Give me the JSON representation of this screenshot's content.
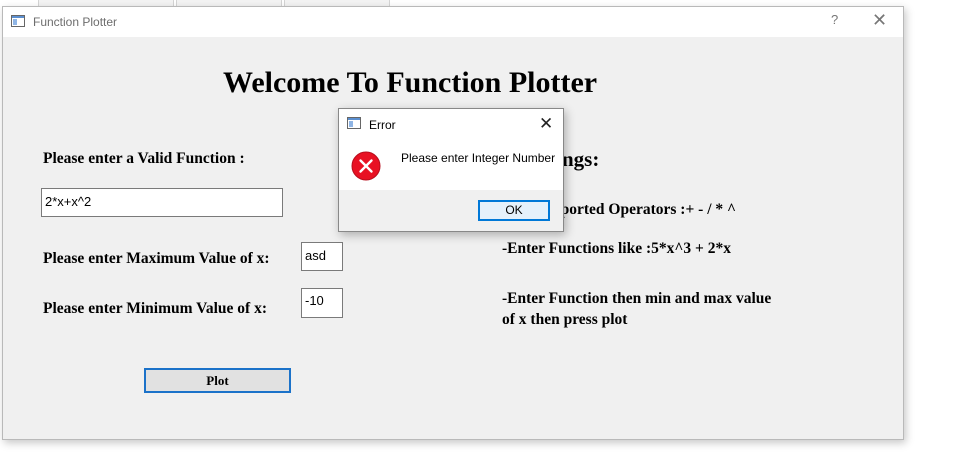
{
  "window": {
    "title": "Function Plotter",
    "help_label": "?",
    "close_label": "✕"
  },
  "main": {
    "heading": "Welcome To Function Plotter",
    "function_label": "Please enter a Valid Function :",
    "function_value": "2*x+x^2",
    "max_label": "Please enter Maximum Value of x:",
    "max_value": "asd",
    "min_label": "Please enter Minimum Value of x:",
    "min_value": "-10",
    "plot_label": "Plot"
  },
  "instructions": {
    "title_visible": "ngs:",
    "line1_visible": "pported Operators :+ - / * ^",
    "line2": "-Enter Functions like :5*x^3 + 2*x",
    "line3a": "-Enter Function then min and max value",
    "line3b": "of x then press plot"
  },
  "dialog": {
    "title": "Error",
    "close_label": "✕",
    "message": "Please enter Integer Number",
    "ok_label": "OK",
    "icon": "error-icon"
  },
  "colors": {
    "window_bg": "#f0f0f0",
    "accent": "#0078d7",
    "error": "#e81123"
  }
}
